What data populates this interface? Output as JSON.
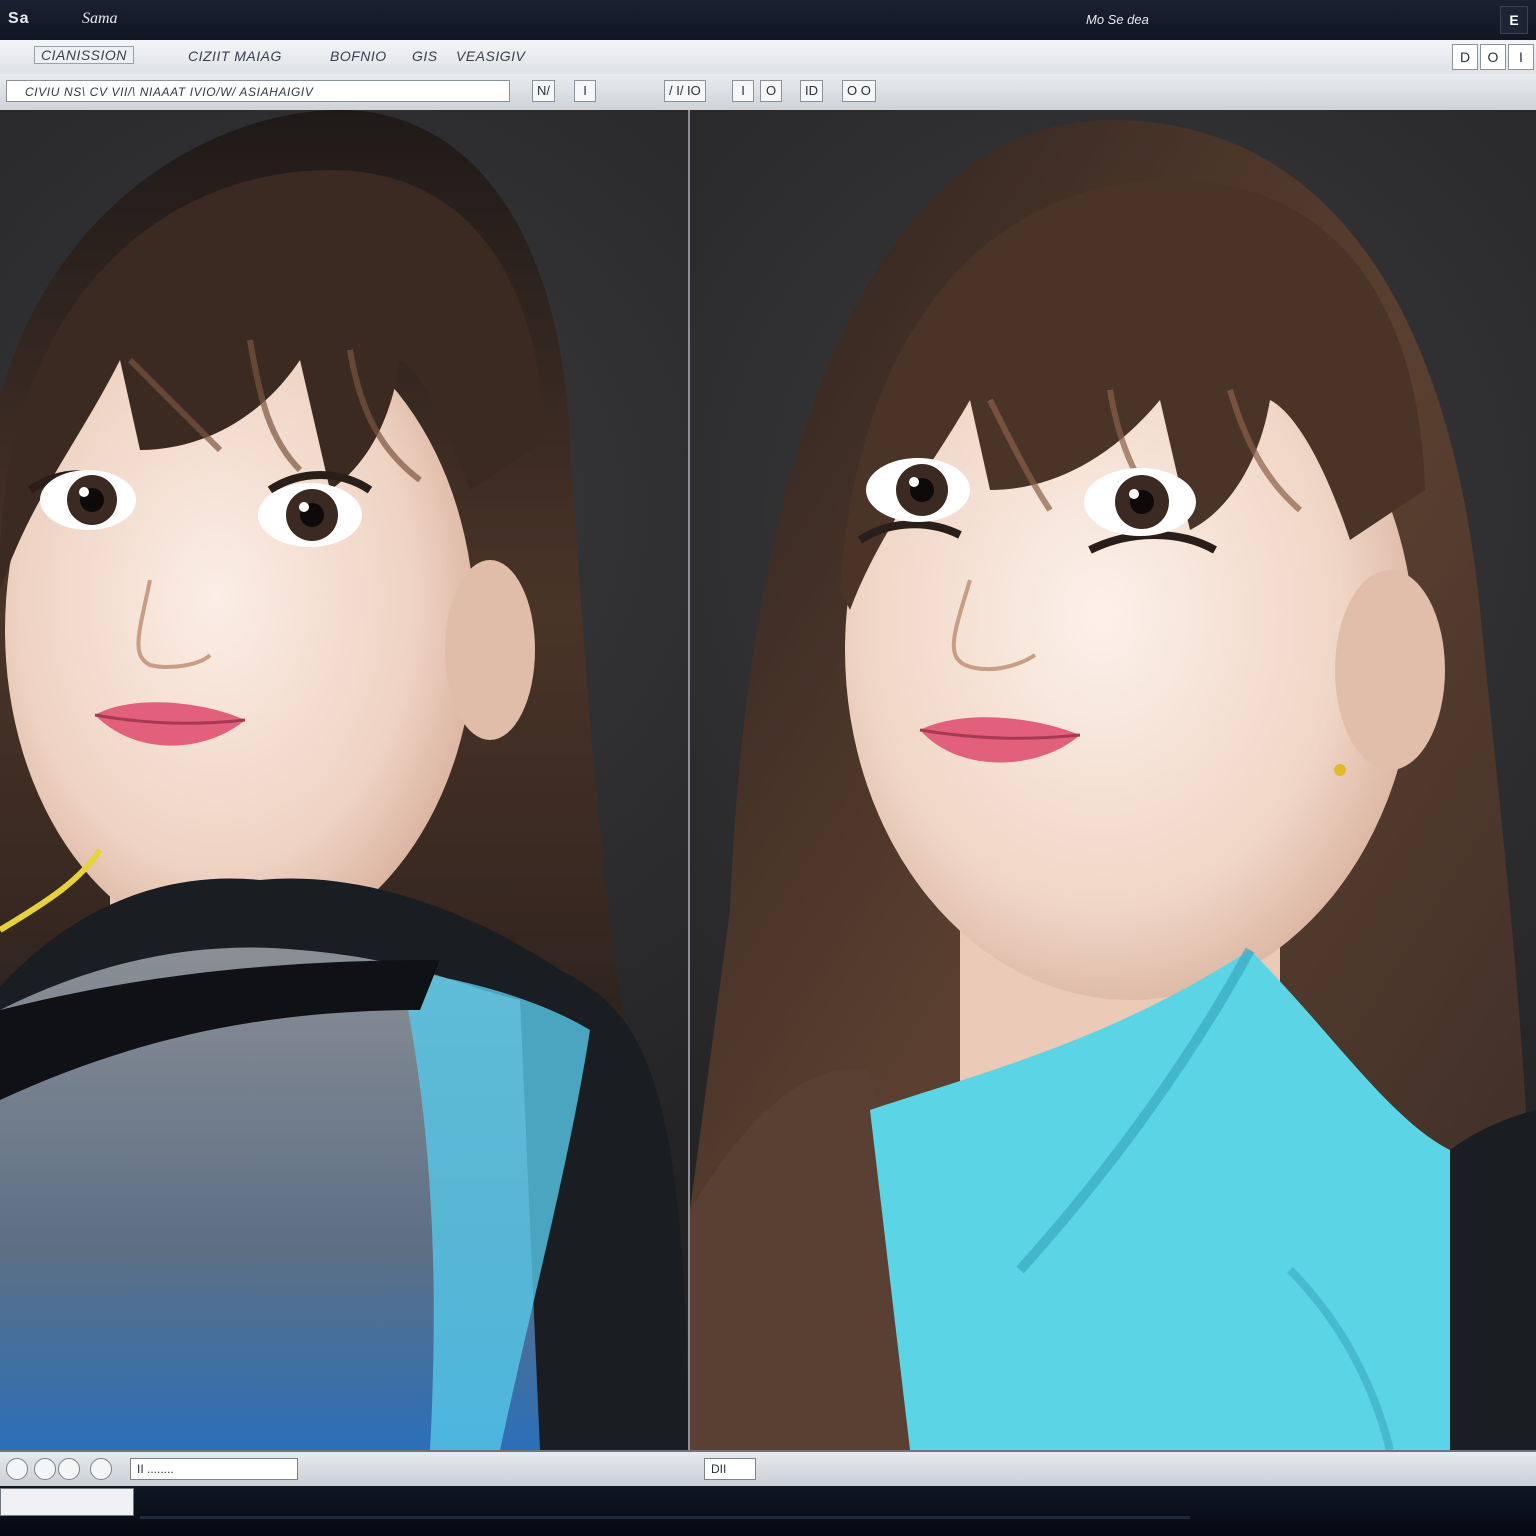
{
  "titlebar": {
    "app_name": "Sa",
    "document_name": "Sama",
    "center_title": "Mo Se dea",
    "window_control": "E"
  },
  "menubar": {
    "items": [
      "CIANISSION",
      "CIZIIT MAIAG",
      "BOFNIO",
      "GIS",
      "VEASIGIV"
    ],
    "right_controls": [
      "D",
      "O",
      "I"
    ]
  },
  "toolbar": {
    "path_field": "CIVIU NS\\ CV VII/\\ NIAAAT IVIO/W/ ASIAHAIGIV",
    "buttons": [
      "N/",
      "I",
      "/ I/ IO",
      "I",
      "O",
      "ID",
      "O O"
    ]
  },
  "panes": {
    "left_label": "portrait-before",
    "right_label": "portrait-after"
  },
  "statusbar": {
    "left_field": "II ........",
    "right_field": "DII"
  },
  "colors": {
    "hair": "#3a2a22",
    "hair_highlight": "#6b4a36",
    "skin": "#f0d8c8",
    "lips": "#e2607c",
    "top_cyan": "#5bd4e6",
    "top_black": "#1a1d22"
  }
}
